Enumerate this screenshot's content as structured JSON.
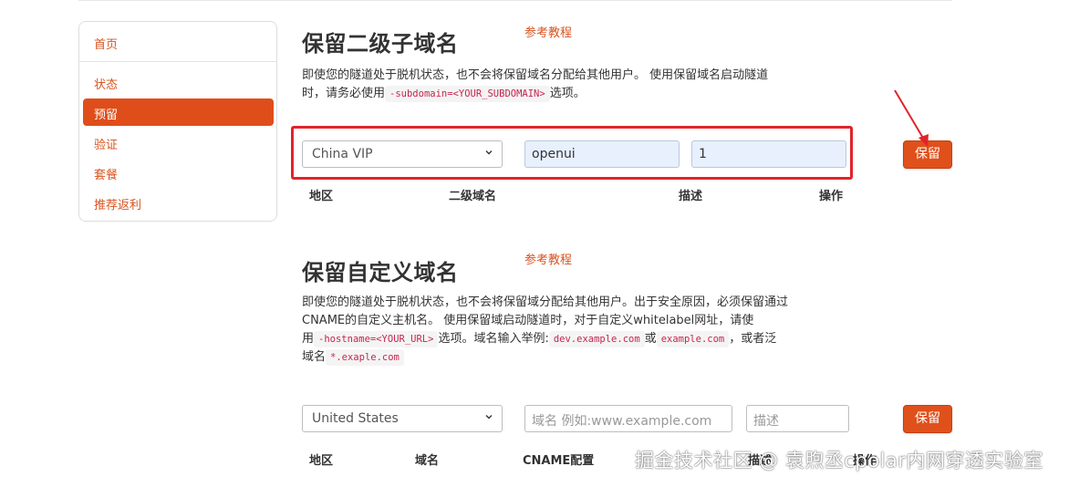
{
  "sidebar": {
    "items": [
      {
        "label": "首页"
      },
      {
        "label": "状态"
      },
      {
        "label": "预留"
      },
      {
        "label": "验证"
      },
      {
        "label": "套餐"
      },
      {
        "label": "推荐返利"
      }
    ],
    "active": "预留"
  },
  "subdomain_section": {
    "title": "保留二级子域名",
    "ref_link": "参考教程",
    "desc_line1": "即使您的隧道处于脱机状态，也不会将保留域名分配给其他用户。 使用保留域名启动隧道",
    "desc_line2_pre": "时，请务必使用",
    "desc_code": "-subdomain=<YOUR_SUBDOMAIN>",
    "desc_line2_post": "选项。",
    "region_value": "China VIP",
    "subdomain_value": "openui",
    "description_value": "1",
    "save_label": "保留",
    "columns": [
      "地区",
      "二级域名",
      "描述",
      "操作"
    ]
  },
  "custom_section": {
    "title": "保留自定义域名",
    "ref_link": "参考教程",
    "desc_line1": "即使您的隧道处于脱机状态，也不会将保留域分配给其他用户。出于安全原因，必须保留通过",
    "desc_line2": "CNAME的自定义主机名。 使用保留域启动隧道时，对于自定义whitelabel网址，请使",
    "desc_line3_pre": "用",
    "code_hostname": "-hostname=<YOUR_URL>",
    "desc_line3_mid": "选项。域名输入举例:",
    "code_example1": "dev.example.com",
    "desc_or": "或",
    "code_example2": "example.com",
    "desc_line3_post": "，或者泛",
    "desc_line4_pre": "域名",
    "code_wildcard": "*.exaple.com",
    "region_value": "United States",
    "domain_placeholder": "域名 例如:www.example.com",
    "description_placeholder": "描述",
    "save_label": "保留",
    "columns": [
      "地区",
      "域名",
      "CNAME配置",
      "描述",
      "操作"
    ]
  },
  "watermark": "掘金技术社区 @ 袁煦丞cpolar内网穿透实验室",
  "colors": {
    "accent": "#df4e1a",
    "highlight_border": "#e0252a",
    "autofill_bg": "#e8f0fe"
  }
}
